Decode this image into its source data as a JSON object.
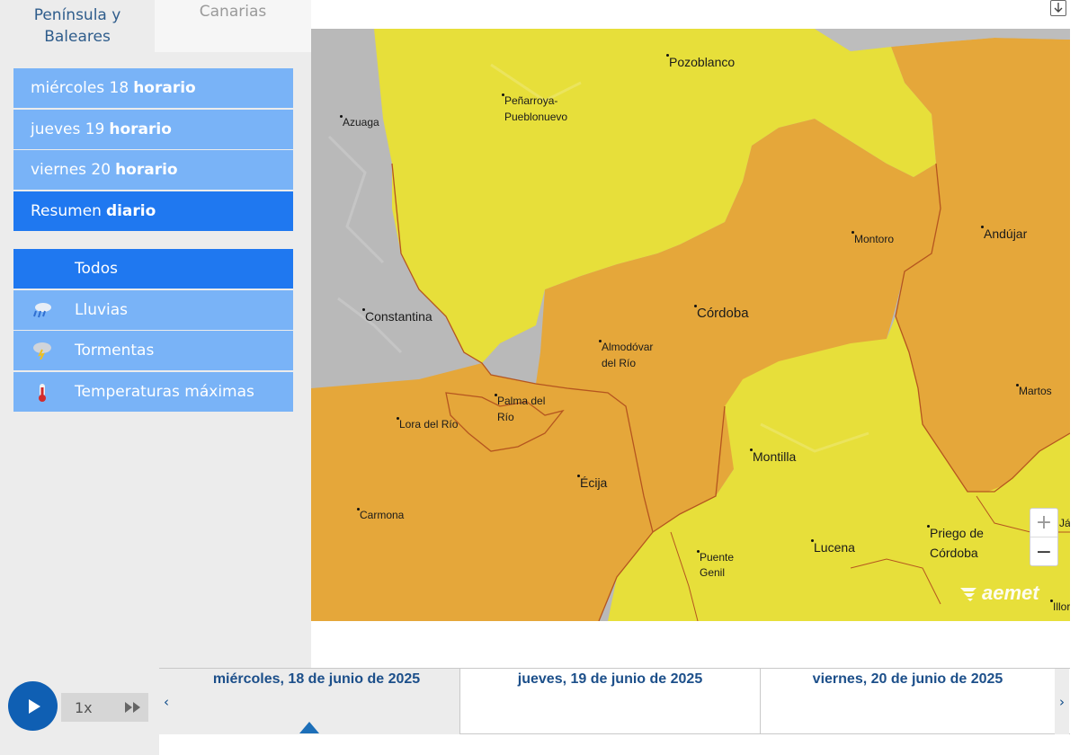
{
  "region_tabs": {
    "peninsula": "Península y Baleares",
    "canarias": "Canarias"
  },
  "days": [
    {
      "prefix": "miércoles 18",
      "suffix": "horario",
      "active": false
    },
    {
      "prefix": "jueves 19",
      "suffix": "horario",
      "active": false
    },
    {
      "prefix": "viernes 20",
      "suffix": "horario",
      "active": false
    },
    {
      "prefix": "Resumen",
      "suffix": "diario",
      "active": true
    }
  ],
  "layers": [
    {
      "label": "Todos",
      "icon": "none",
      "active": true
    },
    {
      "label": "Lluvias",
      "icon": "rain-icon",
      "active": false
    },
    {
      "label": "Tormentas",
      "icon": "storm-icon",
      "active": false
    },
    {
      "label": "Temperaturas máximas",
      "icon": "thermometer-icon",
      "active": false
    }
  ],
  "map": {
    "warning_colors": {
      "yellow": "#e7df3a",
      "orange": "#e5a73a",
      "outside": "#b9b9b9",
      "border": "#b5551f"
    },
    "places": [
      "Pozoblanco",
      "Peñarroya-",
      "Pueblonuevo",
      "Azuaga",
      "Montoro",
      "Andújar",
      "Constantina",
      "Córdoba",
      "Almodóvar",
      "del Río",
      "Martos",
      "Palma del",
      "Río",
      "Lora del Río",
      "Montilla",
      "Écija",
      "Carmona",
      "Priego de",
      "Córdoba",
      "Lucena",
      "Puente",
      "Genil",
      "Illor",
      "Já"
    ],
    "logo_text": "aemet",
    "zoom_in": "+",
    "zoom_out": "−"
  },
  "player": {
    "speed": "1x",
    "icon": "play-icon"
  },
  "timeline": {
    "days": [
      "miércoles, 18 de junio de 2025",
      "jueves, 19 de junio de 2025",
      "viernes, 20 de junio de 2025"
    ],
    "selected_index": 0,
    "prev": "‹",
    "next": "›"
  }
}
